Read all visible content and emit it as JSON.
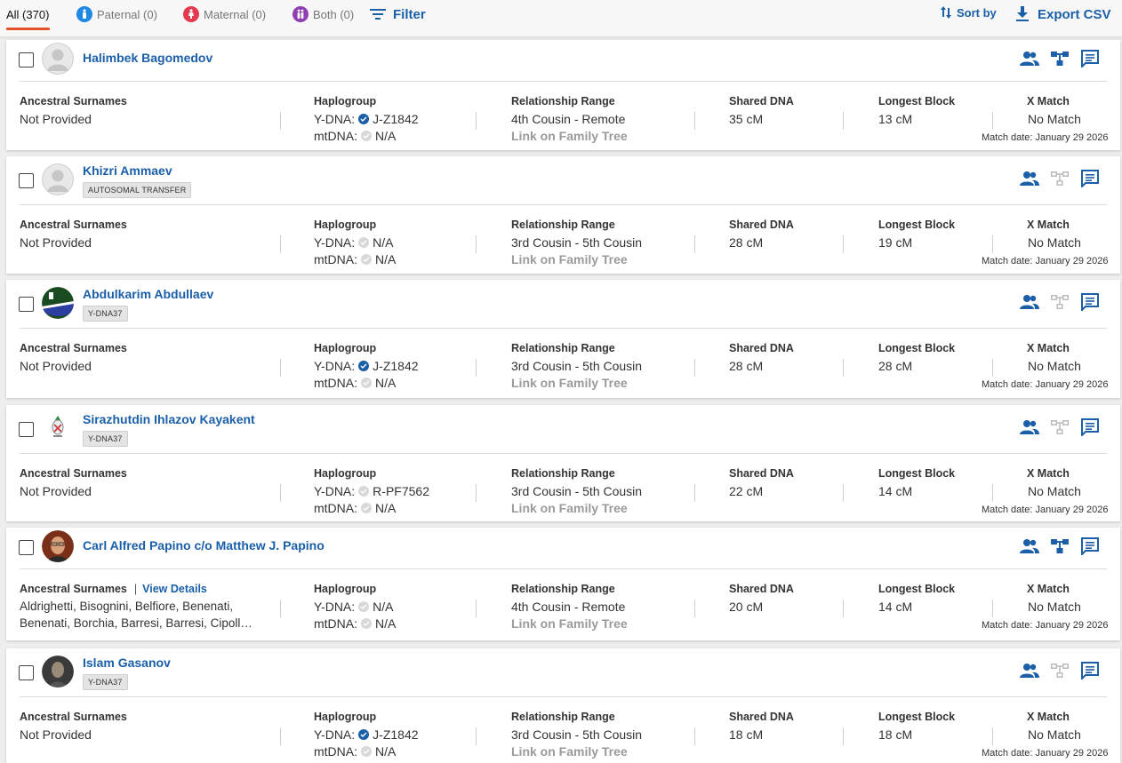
{
  "tabs": {
    "all": "All (370)",
    "paternal": "Paternal (0)",
    "maternal": "Maternal (0)",
    "both": "Both (0)"
  },
  "toolbar": {
    "filter": "Filter",
    "sort": "Sort by",
    "export": "Export CSV"
  },
  "labels": {
    "ancestral_surnames": "Ancestral Surnames",
    "haplogroup": "Haplogroup",
    "relationship_range": "Relationship Range",
    "shared_dna": "Shared DNA",
    "longest_block": "Longest Block",
    "x_match": "X Match",
    "ydna": "Y-DNA:",
    "mtdna": "mtDNA:",
    "link_tree": "Link on Family Tree",
    "view_details": "View Details"
  },
  "colors": {
    "accent": "#1a5fa8",
    "tab_underline": "#e2522a",
    "paternal": "#1e88e5",
    "maternal": "#e53950",
    "both": "#8e3fb0"
  },
  "matches": [
    {
      "name": "Halimbek Bagomedov",
      "badge": "",
      "avatar": "default",
      "surnames": "Not Provided",
      "ydna": "J-Z1842",
      "ydna_confirmed": true,
      "mtdna": "N/A",
      "relationship": "4th Cousin - Remote",
      "shared": "35 cM",
      "longest": "13 cM",
      "x": "No Match",
      "date": "Match date: January 29 2026",
      "tree_linked": true
    },
    {
      "name": "Khizri Ammaev",
      "badge": "AUTOSOMAL TRANSFER",
      "avatar": "default",
      "surnames": "Not Provided",
      "ydna": "N/A",
      "ydna_confirmed": false,
      "mtdna": "N/A",
      "relationship": "3rd Cousin - 5th Cousin",
      "shared": "28 cM",
      "longest": "19 cM",
      "x": "No Match",
      "date": "Match date: January 29 2026",
      "tree_linked": false
    },
    {
      "name": "Abdulkarim Abdullaev",
      "badge": "Y-DNA37",
      "avatar": "flag",
      "surnames": "Not Provided",
      "ydna": "J-Z1842",
      "ydna_confirmed": true,
      "mtdna": "N/A",
      "relationship": "3rd Cousin - 5th Cousin",
      "shared": "28 cM",
      "longest": "28 cM",
      "x": "No Match",
      "date": "Match date: January 29 2026",
      "tree_linked": false
    },
    {
      "name": "Sirazhutdin Ihlazov Kayakent",
      "badge": "Y-DNA37",
      "avatar": "emblem",
      "surnames": "Not Provided",
      "ydna": "R-PF7562",
      "ydna_confirmed": false,
      "mtdna": "N/A",
      "relationship": "3rd Cousin - 5th Cousin",
      "shared": "22 cM",
      "longest": "14 cM",
      "x": "No Match",
      "date": "Match date: January 29 2026",
      "tree_linked": false
    },
    {
      "name": "Carl Alfred Papino c/o Matthew J. Papino",
      "badge": "",
      "avatar": "photo",
      "surnames_line1": "Aldrighetti, Bisognini, Belfiore, Benenati,",
      "surnames_line2": "Benenati, Borchia, Barresi, Barresi, Cipoll…",
      "ydna": "N/A",
      "ydna_confirmed": false,
      "mtdna": "N/A",
      "relationship": "4th Cousin - Remote",
      "shared": "20 cM",
      "longest": "14 cM",
      "x": "No Match",
      "date": "Match date: January 29 2026",
      "tree_linked": true
    },
    {
      "name": "Islam Gasanov",
      "badge": "Y-DNA37",
      "avatar": "photo2",
      "surnames": "Not Provided",
      "ydna": "J-Z1842",
      "ydna_confirmed": true,
      "mtdna": "N/A",
      "relationship": "3rd Cousin - 5th Cousin",
      "shared": "18 cM",
      "longest": "18 cM",
      "x": "No Match",
      "date": "Match date: January 29 2026",
      "tree_linked": false
    }
  ]
}
